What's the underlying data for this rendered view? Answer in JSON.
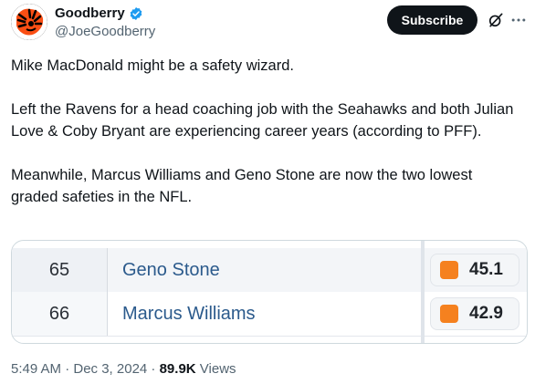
{
  "author": {
    "display_name": "Goodberry",
    "handle": "@JoeGoodberry",
    "verified": true,
    "avatar_icon": "cincinnati-bengals-tiger-logo-icon"
  },
  "header": {
    "subscribe_label": "Subscribe",
    "grok_icon": "grok-icon",
    "more_icon": "more-options-icon"
  },
  "tweet": {
    "paragraphs": [
      "Mike MacDonald might be a safety wizard.",
      "Left the Ravens for a head coaching job with the Seahawks and both Julian Love & Coby Bryant are experiencing career years (according to PFF).",
      "Meanwhile, Marcus Williams and Geno Stone are now the two lowest graded safeties in the NFL."
    ]
  },
  "media_table": {
    "rows": [
      {
        "rank": "65",
        "player": "Geno Stone",
        "grade": "45.1",
        "grade_color": "#f5811f"
      },
      {
        "rank": "66",
        "player": "Marcus Williams",
        "grade": "42.9",
        "grade_color": "#f5811f"
      }
    ]
  },
  "meta": {
    "timestamp": "5:49 AM · Dec 3, 2024 · ",
    "views_count": "89.9K",
    "views_label": " Views"
  },
  "colors": {
    "accent_verified": "#1d9bf0",
    "button_bg": "#0f1419",
    "grade_orange": "#f5811f",
    "player_link": "#2b5a8c"
  }
}
